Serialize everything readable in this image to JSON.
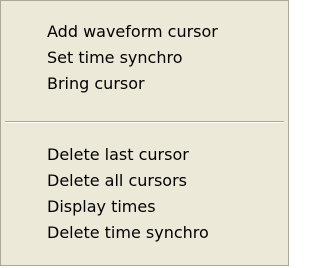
{
  "menu": {
    "items": [
      {
        "label": "Add waveform cursor"
      },
      {
        "label": "Set time synchro"
      },
      {
        "label": "Bring cursor"
      },
      {
        "label": "Delete last cursor"
      },
      {
        "label": "Delete all cursors"
      },
      {
        "label": "Display times"
      },
      {
        "label": "Delete time synchro"
      }
    ]
  },
  "colors": {
    "menu_background": "#ece9d8",
    "menu_border": "#aca899",
    "text": "#000000"
  }
}
